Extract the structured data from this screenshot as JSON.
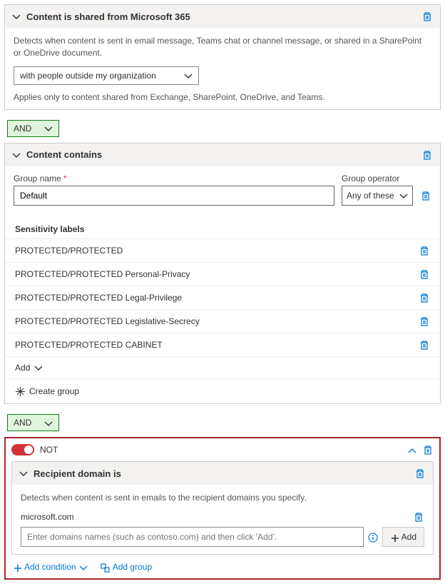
{
  "section1": {
    "title": "Content is shared from Microsoft 365",
    "desc": "Detects when content is sent in email message, Teams chat or channel message, or shared in a SharePoint or OneDrive document.",
    "select_value": "with people outside my organization",
    "applies": "Applies only to content shared from Exchange, SharePoint, OneDrive, and Teams."
  },
  "operator": "AND",
  "section2": {
    "title": "Content contains",
    "group_name_label": "Group name",
    "group_name_value": "Default",
    "group_operator_label": "Group operator",
    "group_operator_value": "Any of these",
    "sensitivity_title": "Sensitivity labels",
    "labels": [
      "PROTECTED/PROTECTED",
      "PROTECTED/PROTECTED Personal-Privacy",
      "PROTECTED/PROTECTED Legal-Privilege",
      "PROTECTED/PROTECTED Legislative-Secrecy",
      "PROTECTED/PROTECTED CABINET"
    ],
    "add_label": "Add",
    "create_group_label": "Create group"
  },
  "not_label": "NOT",
  "section3": {
    "title": "Recipient domain is",
    "desc": "Detects when content is sent in emails to the recipient domains you specify.",
    "domain": "microsoft.com",
    "placeholder": "Enter domains names (such as contoso.com) and then click 'Add'.",
    "add_label": "Add"
  },
  "footer": {
    "add_condition": "Add condition",
    "add_group": "Add group"
  }
}
